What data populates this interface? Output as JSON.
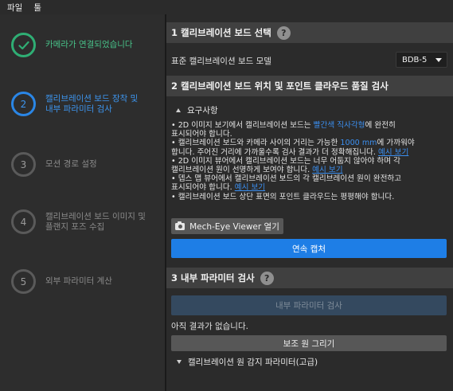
{
  "menu": {
    "file": "파일",
    "tools": "툴"
  },
  "steps": [
    {
      "number": "",
      "label_line1": "카메라가 연결되었습니다",
      "label_line2": ""
    },
    {
      "number": "2",
      "label_line1": "캘리브레이션 보드 장착 및",
      "label_line2": "내부 파라미터 검사"
    },
    {
      "number": "3",
      "label_line1": "모션 경로 설정",
      "label_line2": ""
    },
    {
      "number": "4",
      "label_line1": "캘리브레이션 보드 이미지 및",
      "label_line2": "플랜지 포즈 수집"
    },
    {
      "number": "5",
      "label_line1": "외부 파라미터 계산",
      "label_line2": ""
    }
  ],
  "section1": {
    "title": "1 캘리브레이션 보드 선택",
    "help": "?",
    "model_label": "표준 캘리브레이션 보드 모델",
    "model_value": "BDB-5"
  },
  "section2": {
    "title": "2 캘리브레이션 보드 위치 및 포인트 클라우드 품질 검사",
    "requirements_toggle": "요구사항",
    "req": {
      "l1a": "• 2D 이미지 보기에서 캘리브레이션 보드는 ",
      "l1b": "빨간색 직사각형",
      "l1c": "에 완전히",
      "l2": "표시되어야 합니다.",
      "l3a": "• 캘리브레이션 보드와 카메라 사이의 거리는 가능한 ",
      "l3b": "1000 mm",
      "l3c": "에 가까워야",
      "l4a": "합니다. 주어진 거리에 가까울수록 검사 결과가 더 정확해집니다. ",
      "l4b": "예시 보기",
      "l5": "• 2D 이미지 뷰어에서 캘리브레이션 보드는 너무 어둡지 않아야 하며 각",
      "l6a": "캘리브레이션 원이 선명하게 보여야 합니다. ",
      "l6b": "예시 보기",
      "l7": "• 뎁스 맵 뷰어에서 캘리브레이션 보드의 각 캘리브레이션 원이 완전하고",
      "l8a": "표시되어야 합니다. ",
      "l8b": "예시 보기",
      "l9": "• 캘리브레이션 보드 상단 표면의 포인트 클라우드는 평평해야 합니다."
    },
    "open_viewer_button": "Mech-Eye Viewer 열기",
    "continuous_capture_button": "연속 캡처"
  },
  "section3": {
    "title": "3 내부 파라미터 검사",
    "help": "?",
    "check_button": "내부 파라미터 검사",
    "no_result": "아직 결과가 없습니다.",
    "draw_circle_button": "보조 원 그리기",
    "advanced_toggle": "캘리브레이션 원 감지 파라미터(고급)"
  },
  "colors": {
    "done": "#2fae74",
    "active": "#2a86e6",
    "primary_button": "#1e7ee6",
    "link": "#3b8ff0"
  },
  "icons": [
    "check-icon",
    "help-icon",
    "caret-down-icon",
    "collapse-arrow-icon",
    "camera-icon",
    "expand-arrow-icon"
  ]
}
